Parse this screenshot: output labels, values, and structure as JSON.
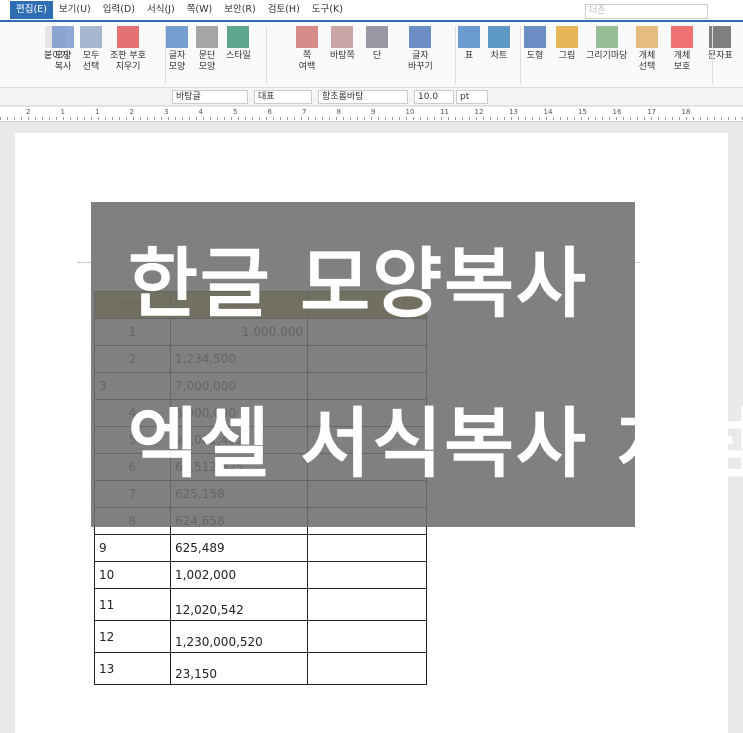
{
  "menu": [
    "편집(E)",
    "보기(U)",
    "입력(D)",
    "서식(J)",
    "쪽(W)",
    "보안(R)",
    "검토(H)",
    "도구(K)"
  ],
  "search_placeholder": "더존",
  "ribbon": [
    "잘라내기",
    "붙이기",
    "모양\n복사",
    "모두\n선택",
    "조판 부호\n지우기",
    "글자\n모양",
    "문단\n모양",
    "스타일",
    "쪽\n여백",
    "바탕쪽",
    "단",
    "글자\n바꾸기",
    "표",
    "차트",
    "도형",
    "그림",
    "그리기마당",
    "개체\n선택",
    "개체\n보호",
    "문자표"
  ],
  "toolbar": {
    "style": "바탕글",
    "lang": "대표",
    "font": "함초롬바탕",
    "size": "10.0",
    "unit": "pt"
  },
  "ruler": [
    "2",
    "1",
    "1",
    "2",
    "3",
    "4",
    "5",
    "6",
    "7",
    "8",
    "9",
    "10",
    "11",
    "12",
    "13",
    "14",
    "15",
    "16",
    "17",
    "18"
  ],
  "table": {
    "headers": [
      "번호",
      "금액",
      "비고"
    ],
    "rows": [
      [
        "1",
        "1,000,000",
        ""
      ],
      [
        "2",
        "1,234,500",
        ""
      ],
      [
        "3",
        "7,000,000",
        ""
      ],
      [
        "4",
        "8,000,000",
        ""
      ],
      [
        "5",
        "90,001,452",
        ""
      ],
      [
        "6",
        "60,512,325",
        ""
      ],
      [
        "7",
        "625,158",
        ""
      ],
      [
        "8",
        "624,658",
        ""
      ],
      [
        "9",
        "625,489",
        ""
      ],
      [
        "10",
        "1,002,000",
        ""
      ],
      [
        "11",
        "12,020,542",
        ""
      ],
      [
        "12",
        "1,230,000,520",
        ""
      ],
      [
        "13",
        "23,150",
        ""
      ]
    ]
  },
  "overlay": {
    "line1": "한글 모양복사",
    "line2": "엑셀 서식복사 처럼"
  }
}
